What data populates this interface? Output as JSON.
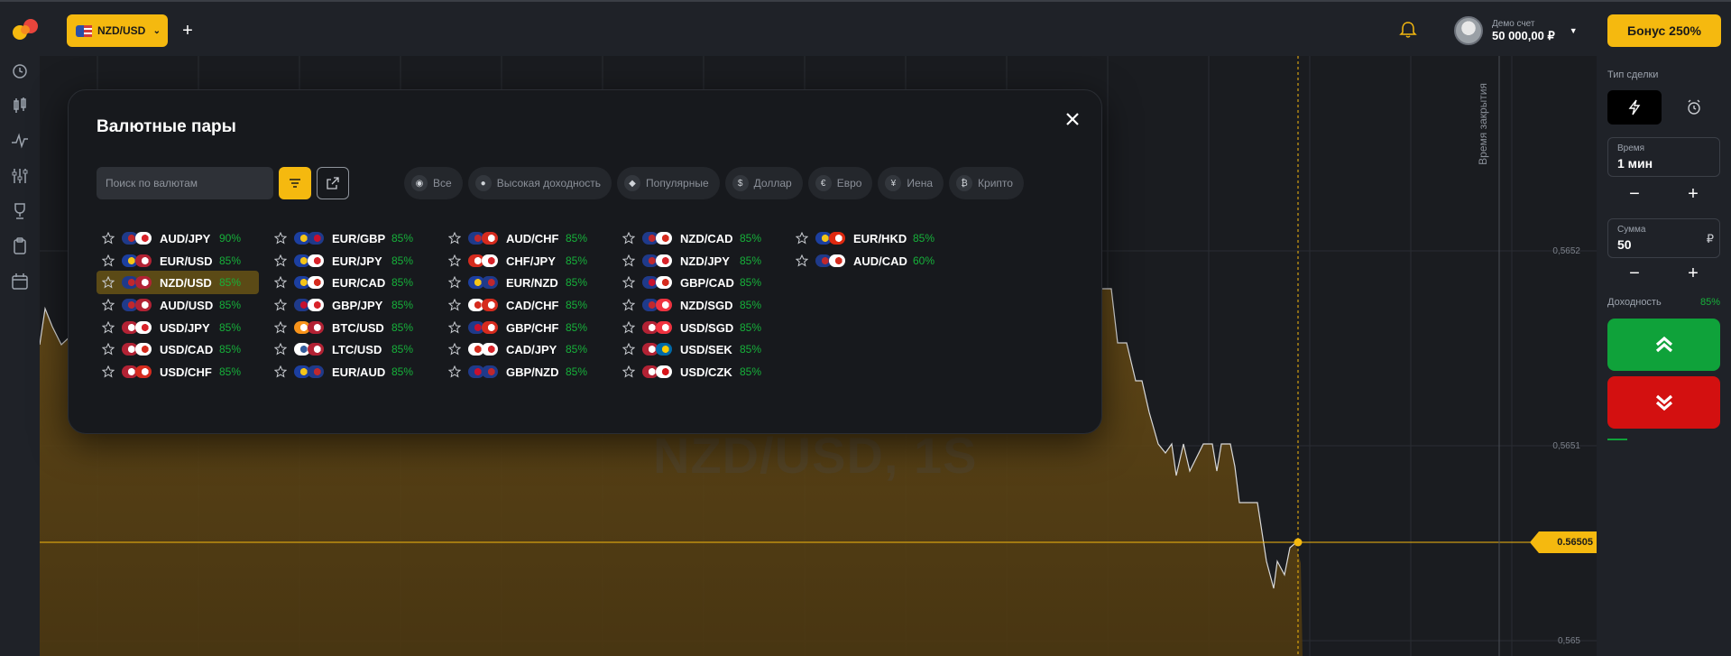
{
  "topbar": {
    "pair_label": "NZD/USD",
    "add_label": "+",
    "account_label": "Демо счет",
    "balance": "50 000,00 ₽",
    "bonus_label": "Бонус 250%"
  },
  "chart": {
    "title": "NZD/USD, 1S",
    "price_labels": [
      "0,5652",
      "0,5651",
      "0,565"
    ],
    "current_price": "0.56505",
    "close_time_label": "Время закрытия"
  },
  "right_panel": {
    "deal_type_label": "Тип сделки",
    "time_label": "Время",
    "time_value": "1 мин",
    "amount_label": "Сумма",
    "amount_value": "50",
    "currency_symbol": "₽",
    "minus": "−",
    "plus": "+",
    "yield_label": "Доходность",
    "yield_value": "85%"
  },
  "modal": {
    "title": "Валютные пары",
    "search_placeholder": "Поиск по валютам",
    "categories": [
      "Все",
      "Высокая доходность",
      "Популярные",
      "Доллар",
      "Евро",
      "Иена",
      "Крипто"
    ],
    "columns": [
      [
        {
          "name": "AUD/JPY",
          "yield": "90%",
          "flags": [
            "au",
            "jp"
          ]
        },
        {
          "name": "EUR/USD",
          "yield": "85%",
          "flags": [
            "eu",
            "us"
          ]
        },
        {
          "name": "NZD/USD",
          "yield": "85%",
          "flags": [
            "nz",
            "us"
          ],
          "selected": true
        },
        {
          "name": "AUD/USD",
          "yield": "85%",
          "flags": [
            "au",
            "us"
          ]
        },
        {
          "name": "USD/JPY",
          "yield": "85%",
          "flags": [
            "us",
            "jp"
          ]
        },
        {
          "name": "USD/CAD",
          "yield": "85%",
          "flags": [
            "us",
            "ca"
          ]
        },
        {
          "name": "USD/CHF",
          "yield": "85%",
          "flags": [
            "us",
            "ch"
          ]
        }
      ],
      [
        {
          "name": "EUR/GBP",
          "yield": "85%",
          "flags": [
            "eu",
            "gb"
          ]
        },
        {
          "name": "EUR/JPY",
          "yield": "85%",
          "flags": [
            "eu",
            "jp"
          ]
        },
        {
          "name": "EUR/CAD",
          "yield": "85%",
          "flags": [
            "eu",
            "ca"
          ]
        },
        {
          "name": "GBP/JPY",
          "yield": "85%",
          "flags": [
            "gb",
            "jp"
          ]
        },
        {
          "name": "BTC/USD",
          "yield": "85%",
          "flags": [
            "btc",
            "us"
          ]
        },
        {
          "name": "LTC/USD",
          "yield": "85%",
          "flags": [
            "ltc",
            "us"
          ]
        },
        {
          "name": "EUR/AUD",
          "yield": "85%",
          "flags": [
            "eu",
            "au"
          ]
        }
      ],
      [
        {
          "name": "AUD/CHF",
          "yield": "85%",
          "flags": [
            "au",
            "ch"
          ]
        },
        {
          "name": "CHF/JPY",
          "yield": "85%",
          "flags": [
            "ch",
            "jp"
          ]
        },
        {
          "name": "EUR/NZD",
          "yield": "85%",
          "flags": [
            "eu",
            "nz"
          ]
        },
        {
          "name": "CAD/CHF",
          "yield": "85%",
          "flags": [
            "ca",
            "ch"
          ]
        },
        {
          "name": "GBP/CHF",
          "yield": "85%",
          "flags": [
            "gb",
            "ch"
          ]
        },
        {
          "name": "CAD/JPY",
          "yield": "85%",
          "flags": [
            "ca",
            "jp"
          ]
        },
        {
          "name": "GBP/NZD",
          "yield": "85%",
          "flags": [
            "gb",
            "nz"
          ]
        }
      ],
      [
        {
          "name": "NZD/CAD",
          "yield": "85%",
          "flags": [
            "nz",
            "ca"
          ]
        },
        {
          "name": "NZD/JPY",
          "yield": "85%",
          "flags": [
            "nz",
            "jp"
          ]
        },
        {
          "name": "GBP/CAD",
          "yield": "85%",
          "flags": [
            "gb",
            "ca"
          ]
        },
        {
          "name": "NZD/SGD",
          "yield": "85%",
          "flags": [
            "nz",
            "sg"
          ]
        },
        {
          "name": "USD/SGD",
          "yield": "85%",
          "flags": [
            "us",
            "sg"
          ]
        },
        {
          "name": "USD/SEK",
          "yield": "85%",
          "flags": [
            "us",
            "se"
          ]
        },
        {
          "name": "USD/CZK",
          "yield": "85%",
          "flags": [
            "us",
            "cz"
          ]
        }
      ],
      [
        {
          "name": "EUR/HKD",
          "yield": "85%",
          "flags": [
            "eu",
            "hk"
          ]
        },
        {
          "name": "AUD/CAD",
          "yield": "60%",
          "flags": [
            "au",
            "ca"
          ]
        }
      ]
    ]
  },
  "colors": {
    "accent": "#f5b90f",
    "up": "#0fa23a",
    "down": "#d31010",
    "yield_green": "#17b13a",
    "background": "#1c1f24"
  }
}
